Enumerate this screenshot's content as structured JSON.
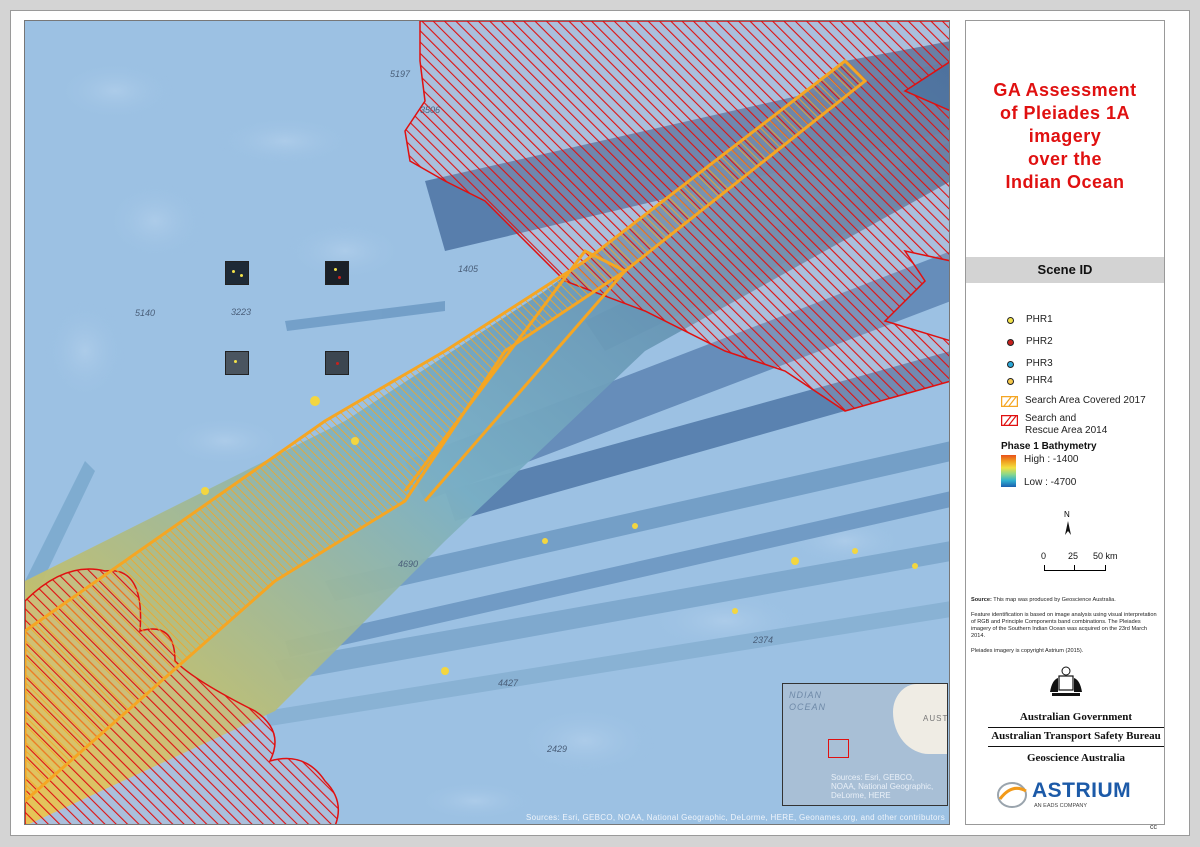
{
  "title_lines": [
    "GA Assessment",
    "of Pleiades 1A",
    "imagery",
    "over the",
    "Indian Ocean"
  ],
  "scene_id_label": "Scene ID",
  "legend": {
    "phr": [
      {
        "label": "PHR1",
        "color": "#f2e24a"
      },
      {
        "label": "PHR2",
        "color": "#c8201c"
      },
      {
        "label": "PHR3",
        "color": "#2aa7d8"
      },
      {
        "label": "PHR4",
        "color": "#f7c94a"
      }
    ],
    "search_area": "Search Area Covered 2017",
    "sar_area_lines": [
      "Search and",
      "Rescue Area 2014"
    ],
    "bathymetry_title": "Phase 1 Bathymetry",
    "high_label": "High : -1400",
    "low_label": "Low : -4700"
  },
  "north_label": "N",
  "scale": {
    "labels": [
      "0",
      "25",
      "50 km"
    ]
  },
  "notes": {
    "source_label": "Source:",
    "source_text": "This map was produced by Geoscience Australia.",
    "feature_text": "Feature identification is based on image analysis using visual interpretation of RGB and Principle Components band combinations. The Pleiades imagery of the Southern Indian Ocean was acquired on the 23rd March 2014.",
    "copyright_text": "Pleiades imagery is copyright Astrium (2015)."
  },
  "government": {
    "line1": "Australian Government",
    "line2": "Australian Transport Safety Bureau",
    "line3": "Geoscience Australia"
  },
  "astrium": {
    "name": "ASTRIUM",
    "subtitle": "AN EADS COMPANY"
  },
  "map": {
    "attribution": "Sources: Esri, GEBCO, NOAA, National Geographic, DeLorme, HERE, Geonames.org, and other contributors",
    "depth_labels": [
      "5197",
      "3506",
      "1405",
      "5140",
      "3223",
      "4690",
      "2374",
      "4427",
      "2429"
    ],
    "inset": {
      "ocean_label_1": "NDIAN",
      "ocean_label_2": "OCEAN",
      "land_label": "AUSTR",
      "source_lines": [
        "Sources: Esri, GEBCO,",
        "NOAA, National Geographic,",
        "DeLorme, HERE"
      ]
    }
  },
  "colors": {
    "ocean": "#9cc1e3",
    "sar_red": "#e01010",
    "search_orange": "#f5a623",
    "title_red": "#e01010"
  },
  "cc_badge": "cc"
}
